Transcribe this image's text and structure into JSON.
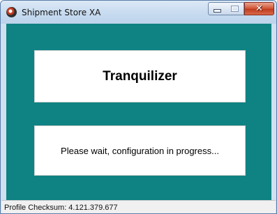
{
  "window": {
    "title": "Shipment Store XA",
    "close_glyph": "✕"
  },
  "main": {
    "app_name": "Tranquilizer",
    "status_message": "Please wait, configuration in progress..."
  },
  "statusbar": {
    "text": "Profile Checksum: 4.121.379.677"
  },
  "colors": {
    "client_background": "#0f8283",
    "panel_background": "#ffffff",
    "close_button": "#c13c1f"
  },
  "icons": {
    "app": "app-icon",
    "minimize": "minimize-icon",
    "maximize": "maximize-icon",
    "close": "close-icon"
  }
}
